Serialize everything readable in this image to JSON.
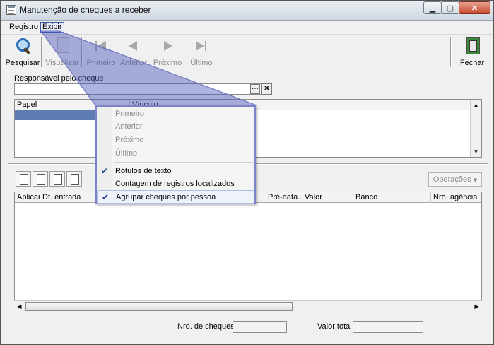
{
  "window": {
    "title": "Manutenção de cheques a receber",
    "controls": {
      "minimize": "▁",
      "maximize": "▢",
      "close": "✕"
    }
  },
  "menubar": {
    "items": [
      {
        "label": "Registro"
      },
      {
        "label": "Exibir"
      }
    ]
  },
  "toolbar": {
    "buttons": [
      {
        "label": "Pesquisar",
        "icon": "search-icon",
        "enabled": true
      },
      {
        "label": "Visualizar",
        "icon": "document-icon",
        "enabled": false
      },
      {
        "label": "Primeiro",
        "icon": "first-icon",
        "enabled": false
      },
      {
        "label": "Anterior",
        "icon": "previous-icon",
        "enabled": false
      },
      {
        "label": "Próximo",
        "icon": "next-icon",
        "enabled": false
      },
      {
        "label": "Último",
        "icon": "last-icon",
        "enabled": false
      },
      {
        "label": "Fechar",
        "icon": "exit-door-icon",
        "enabled": true
      }
    ]
  },
  "responsavel": {
    "label": "Responsável pelo cheque",
    "value": "",
    "browse_label": "···",
    "clear_label": "✕"
  },
  "papel_grid": {
    "columns": [
      "Papel",
      "Vínculo"
    ]
  },
  "cheques": {
    "operations_label": "Operações",
    "columns": [
      "Aplicar",
      "Dt. entrada",
      "Pré-data...",
      "Valor",
      "Banco",
      "Nro. agência"
    ],
    "rows": []
  },
  "totals": {
    "count_label": "Nro. de cheques",
    "count_value": "",
    "total_label": "Valor total",
    "total_value": ""
  },
  "exibir_menu": {
    "items": [
      {
        "label": "Primeiro",
        "enabled": false,
        "checked": false
      },
      {
        "label": "Anterior",
        "enabled": false,
        "checked": false
      },
      {
        "label": "Próximo",
        "enabled": false,
        "checked": false
      },
      {
        "label": "Último",
        "enabled": false,
        "checked": false
      },
      {
        "label": "Rótulos de texto",
        "enabled": true,
        "checked": true
      },
      {
        "label": "Contagem de registros localizados",
        "enabled": true,
        "checked": false
      },
      {
        "label": "Agrupar cheques por pessoa",
        "enabled": true,
        "checked": true
      }
    ],
    "check_glyph": "✔"
  },
  "colors": {
    "callout_fill": "#4a55b5",
    "menu_border": "#7b84c8",
    "selection_row": "#5d7cb3"
  }
}
